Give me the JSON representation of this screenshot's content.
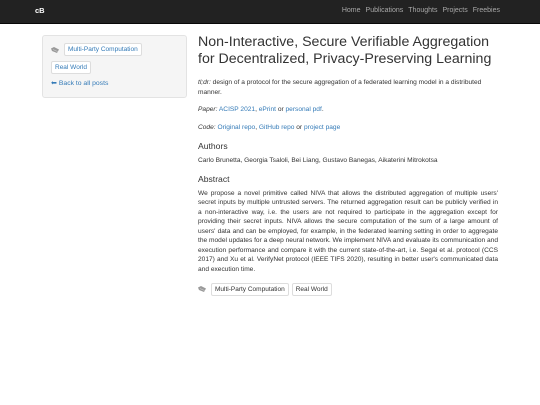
{
  "navbar": {
    "brand": "cB",
    "links": [
      "Home",
      "Publications",
      "Thoughts",
      "Projects",
      "Freebies"
    ]
  },
  "sidebar": {
    "tags": [
      "Multi-Party Computation",
      "Real World"
    ],
    "back_link": "Back to all posts"
  },
  "post": {
    "title": "Non-Interactive, Secure Verifiable Aggregation for Decentralized, Privacy-Preserving Learning",
    "tldr_label": "tl;dr:",
    "tldr_text": " design of a protocol for the secure aggregation of a federated learning model in a distributed manner.",
    "paper_label": "Paper:",
    "paper_link1": "ACISP 2021",
    "paper_sep1": ", ",
    "paper_link2": "ePrint",
    "paper_sep2": " or ",
    "paper_link3": "personal pdf",
    "paper_end": ".",
    "code_label": "Code:",
    "code_link1": "Original repo",
    "code_sep1": ", ",
    "code_link2": "GitHub repo",
    "code_sep2": " or ",
    "code_link3": "project page",
    "authors_heading": "Authors",
    "authors": "Carlo Brunetta, Georgia Tsaloli, Bei Liang, Gustavo Banegas, Aikaterini Mitrokotsa",
    "abstract_heading": "Abstract",
    "abstract": "We propose a novel primitive called NIVA that allows the distributed aggregation of multiple users' secret inputs by multiple untrusted servers. The returned aggregation result can be publicly verified in a non-interactive way, i.e. the users are not required to participate in the aggregation except for providing their secret inputs. NIVA allows the secure computation of the sum of a large amount of users' data and can be employed, for example, in the federated learning setting in order to aggregate the model updates for a deep neural network. We implement NIVA and evaluate its communication and execution performance and compare it with the current state-of-the-art, i.e. Segal et al. protocol (CCS 2017) and Xu et al. VerifyNet protocol (IEEE TIFS 2020), resulting in better user's communicated data and execution time.",
    "tags": [
      "Multi-Party Computation",
      "Real World"
    ]
  },
  "colors": {
    "navbar": "#222222",
    "link": "#337ab7",
    "sidebar_bg": "#f5f5f5"
  },
  "icons": [
    "tag-icon",
    "back-arrow-icon"
  ]
}
